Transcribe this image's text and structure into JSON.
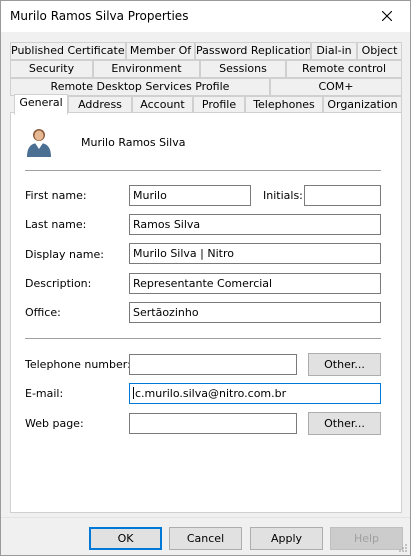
{
  "window": {
    "title": "Murilo Ramos Silva Properties"
  },
  "tabs": {
    "row1": [
      "Published Certificates",
      "Member Of",
      "Password Replication",
      "Dial-in",
      "Object"
    ],
    "row2": [
      "Security",
      "Environment",
      "Sessions",
      "Remote control"
    ],
    "row3": [
      "Remote Desktop Services Profile",
      "COM+"
    ],
    "row4": [
      "General",
      "Address",
      "Account",
      "Profile",
      "Telephones",
      "Organization"
    ],
    "active": "General"
  },
  "general": {
    "display_header": "Murilo Ramos Silva",
    "labels": {
      "first_name": "First name:",
      "initials": "Initials:",
      "last_name": "Last name:",
      "display_name": "Display name:",
      "description": "Description:",
      "office": "Office:",
      "telephone": "Telephone number:",
      "email": "E-mail:",
      "web_page": "Web page:"
    },
    "values": {
      "first_name": "Murilo",
      "initials": "",
      "last_name": "Ramos Silva",
      "display_name": "Murilo Silva | Nitro",
      "description": "Representante Comercial",
      "office": "Sertãozinho",
      "telephone": "",
      "email": "c.murilo.silva@nitro.com.br",
      "web_page": ""
    },
    "other_label": "Other..."
  },
  "buttons": {
    "ok": "OK",
    "cancel": "Cancel",
    "apply": "Apply",
    "help": "Help"
  },
  "icons": {
    "user": "user-icon",
    "close": "close-icon"
  }
}
